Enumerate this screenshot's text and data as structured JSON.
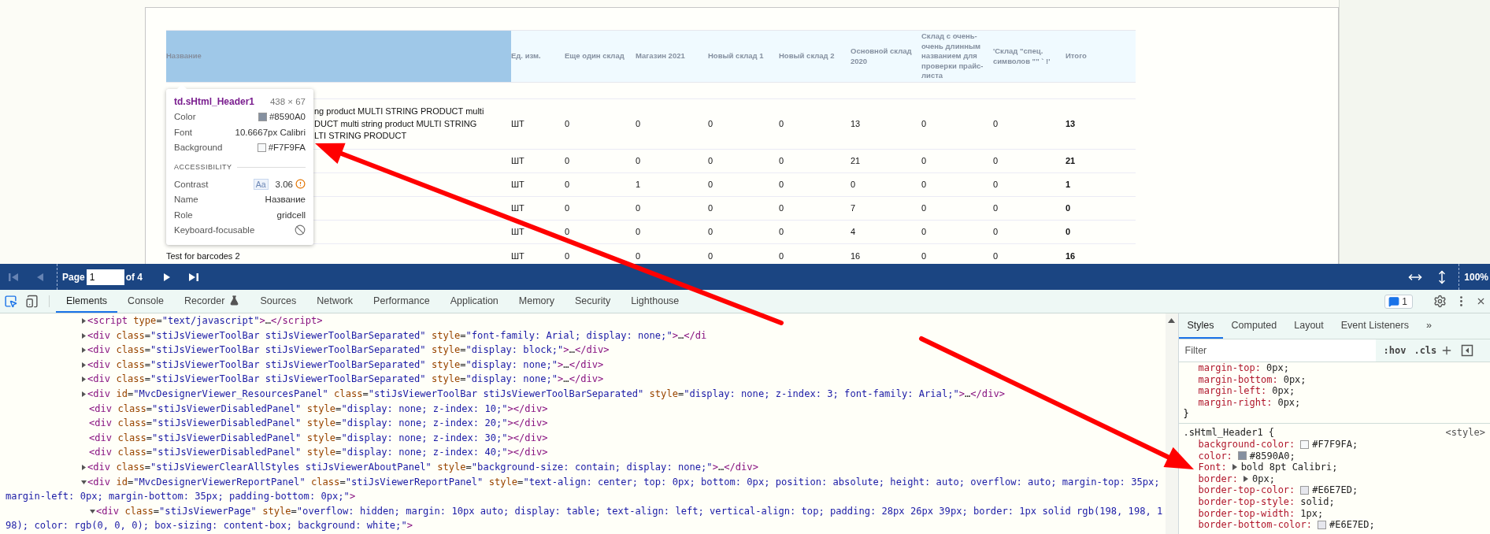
{
  "report": {
    "columns": [
      {
        "label": "Название",
        "highlighted": true
      },
      {
        "label": "Ед. изм.",
        "highlighted": false
      },
      {
        "label": "Еще один склад",
        "highlighted": false
      },
      {
        "label": "Магазин 2021",
        "highlighted": false
      },
      {
        "label": "Новый склад 1",
        "highlighted": false
      },
      {
        "label": "Новый склад 2",
        "highlighted": false
      },
      {
        "label": "Основной склад 2020",
        "highlighted": false
      },
      {
        "label": "Склад с очень-очень длинным названием для проверки прайс-листа",
        "highlighted": false
      },
      {
        "label": "'Склад \"спец. символов \"\" ` !'",
        "highlighted": false
      },
      {
        "label": "Итого",
        "highlighted": false
      }
    ],
    "rows": [
      {
        "kind": "group"
      },
      {
        "kind": "item",
        "covered": true,
        "name_lines": [
          "ng product MULTI STRING PRODUCT multi",
          "DUCT multi string product MULTI STRING",
          "LTI STRING PRODUCT"
        ],
        "unit": "ШТ",
        "values": [
          "0",
          "0",
          "0",
          "0",
          "13",
          "0",
          "0"
        ],
        "total": "13"
      },
      {
        "kind": "item",
        "unit": "ШТ",
        "values": [
          "0",
          "0",
          "0",
          "0",
          "21",
          "0",
          "0"
        ],
        "total": "21"
      },
      {
        "kind": "item",
        "unit": "ШТ",
        "values": [
          "0",
          "1",
          "0",
          "0",
          "0",
          "0",
          "0"
        ],
        "total": "1"
      },
      {
        "kind": "item",
        "unit": "ШТ",
        "values": [
          "0",
          "0",
          "0",
          "0",
          "7",
          "0",
          "0"
        ],
        "total": "0"
      },
      {
        "kind": "item",
        "unit": "ШТ",
        "values": [
          "0",
          "0",
          "0",
          "0",
          "4",
          "0",
          "0"
        ],
        "total": "0"
      },
      {
        "kind": "item",
        "name_lines": [
          "Test for barcodes 2"
        ],
        "unit": "ШТ",
        "values": [
          "0",
          "0",
          "0",
          "0",
          "16",
          "0",
          "0"
        ],
        "total": "16"
      }
    ]
  },
  "inspect_tooltip": {
    "selector": "td.sHtml_Header1",
    "size": "438 × 67",
    "properties": [
      {
        "label": "Color",
        "value": "#8590A0",
        "swatch": true
      },
      {
        "label": "Font",
        "value": "10.6667px Calibri",
        "swatch": false
      },
      {
        "label": "Background",
        "value": "#F7F9FA",
        "swatch": true
      }
    ],
    "section": "ACCESSIBILITY",
    "accessibility": [
      {
        "kind": "contrast",
        "label": "Contrast",
        "badge": "Aa",
        "value": "3.06"
      },
      {
        "kind": "text",
        "label": "Name",
        "value": "Название"
      },
      {
        "kind": "text",
        "label": "Role",
        "value": "gridcell"
      },
      {
        "kind": "blocked",
        "label": "Keyboard-focusable"
      }
    ]
  },
  "viewer_toolbar": {
    "nav_back": [
      {
        "kind": "first",
        "disabled": true
      },
      {
        "kind": "previous",
        "disabled": true
      }
    ],
    "page_label": "Page",
    "page_value": "1",
    "page_count": "of 4",
    "nav_forward": [
      {
        "kind": "next",
        "disabled": false
      },
      {
        "kind": "last",
        "disabled": false
      }
    ],
    "zoom": "100%"
  },
  "devtools": {
    "tabs": [
      {
        "label": "Elements",
        "kind": "plain",
        "selected": true
      },
      {
        "label": "Console",
        "kind": "plain",
        "selected": false
      },
      {
        "label": "Recorder",
        "kind": "experimental",
        "selected": false
      },
      {
        "label": "Sources",
        "kind": "plain",
        "selected": false
      },
      {
        "label": "Network",
        "kind": "plain",
        "selected": false
      },
      {
        "label": "Performance",
        "kind": "plain",
        "selected": false
      },
      {
        "label": "Application",
        "kind": "plain",
        "selected": false
      },
      {
        "label": "Memory",
        "kind": "plain",
        "selected": false
      },
      {
        "label": "Security",
        "kind": "plain",
        "selected": false
      },
      {
        "label": "Lighthouse",
        "kind": "plain",
        "selected": false
      }
    ],
    "issues_count": "1"
  },
  "dom_tree": [
    {
      "text": "<script type=\"text/javascript\">…</script>",
      "kind": "parent",
      "expanded": false
    },
    {
      "text": "<div class=\"stiJsViewerToolBar stiJsViewerToolBarSeparated\" style=\"font-family: Arial; display: none;\">…</di",
      "kind": "parent",
      "expanded": false
    },
    {
      "text": "<div class=\"stiJsViewerToolBar stiJsViewerToolBarSeparated\" style=\"display: block;\">…</div>",
      "kind": "parent",
      "expanded": false
    },
    {
      "text": "<div class=\"stiJsViewerToolBar stiJsViewerToolBarSeparated\" style=\"display: none;\">…</div>",
      "kind": "parent",
      "expanded": false
    },
    {
      "text": "<div class=\"stiJsViewerToolBar stiJsViewerToolBarSeparated\" style=\"display: none;\">…</div>",
      "kind": "parent",
      "expanded": false
    },
    {
      "text": "<div id=\"MvcDesignerViewer_ResourcesPanel\" class=\"stiJsViewerToolBar stiJsViewerToolBarSeparated\" style=\"display: none; z-index: 3; font-family: Arial;\">…</div>",
      "kind": "parent",
      "expanded": false
    },
    {
      "text": "<div class=\"stiJsViewerDisabledPanel\" style=\"display: none; z-index: 10;\"></div>",
      "kind": "leaf"
    },
    {
      "text": "<div class=\"stiJsViewerDisabledPanel\" style=\"display: none; z-index: 20;\"></div>",
      "kind": "leaf"
    },
    {
      "text": "<div class=\"stiJsViewerDisabledPanel\" style=\"display: none; z-index: 30;\"></div>",
      "kind": "leaf"
    },
    {
      "text": "<div class=\"stiJsViewerDisabledPanel\" style=\"display: none; z-index: 40;\"></div>",
      "kind": "leaf"
    },
    {
      "text": "<div class=\"stiJsViewerClearAllStyles stiJsViewerAboutPanel\" style=\"background-size: contain; display: none;\">…</div>",
      "kind": "parent",
      "expanded": false
    },
    {
      "text": "<div id=\"MvcDesignerViewerReportPanel\" class=\"stiJsViewerReportPanel\" style=\"text-align: center; top: 0px; bottom: 0px; position: absolute; height: auto; overflow: auto; margin-top: 35px; margin-left: 0px; margin-bottom: 35px; padding-bottom: 0px;\">",
      "kind": "parent",
      "expanded": true,
      "children": [
        {
          "text": "<div class=\"stiJsViewerPage\" style=\"overflow: hidden; margin: 10px auto; display: table; text-align: left; vertical-align: top; padding: 28px 26px 39px; border: 1px solid rgb(198, 198, 198); color: rgb(0, 0, 0); box-sizing: content-box; background: white;\">",
          "kind": "parent",
          "expanded": true
        }
      ]
    }
  ],
  "styles_pane": {
    "tabs": [
      {
        "label": "Styles",
        "selected": true
      },
      {
        "label": "Computed",
        "selected": false
      },
      {
        "label": "Layout",
        "selected": false
      },
      {
        "label": "Event Listeners",
        "selected": false
      }
    ],
    "more": "»",
    "filter": {
      "placeholder": "Filter"
    },
    "toggles": [
      ":hov",
      ".cls"
    ],
    "rules": [
      {
        "declarations": [
          {
            "name": "margin-top:",
            "value": "0px;",
            "expandable": false,
            "swatch": false
          },
          {
            "name": "margin-bottom:",
            "value": "0px;",
            "expandable": false,
            "swatch": false
          },
          {
            "name": "margin-left:",
            "value": "0px;",
            "expandable": false,
            "swatch": false
          },
          {
            "name": "margin-right:",
            "value": "0px;",
            "expandable": false,
            "swatch": false
          }
        ],
        "closing": "}"
      },
      {
        "selector": ".sHtml_Header1 {",
        "source": "<style>",
        "declarations": [
          {
            "name": "background-color:",
            "value": "#F7F9FA;",
            "swatch": true,
            "expandable": false
          },
          {
            "name": "color:",
            "value": "#8590A0;",
            "swatch": true,
            "expandable": false
          },
          {
            "name": "Font:",
            "value": "bold 8pt Calibri;",
            "swatch": false,
            "expandable": true
          },
          {
            "name": "border:",
            "value": "0px;",
            "swatch": false,
            "expandable": true
          },
          {
            "name": "border-top-color:",
            "value": "#E6E7ED;",
            "swatch": true,
            "expandable": false
          },
          {
            "name": "border-top-style:",
            "value": "solid;",
            "swatch": false,
            "expandable": false
          },
          {
            "name": "border-top-width:",
            "value": "1px;",
            "swatch": false,
            "expandable": false
          },
          {
            "name": "border-bottom-color:",
            "value": "#E6E7ED;",
            "swatch": true,
            "expandable": false
          }
        ]
      }
    ]
  }
}
